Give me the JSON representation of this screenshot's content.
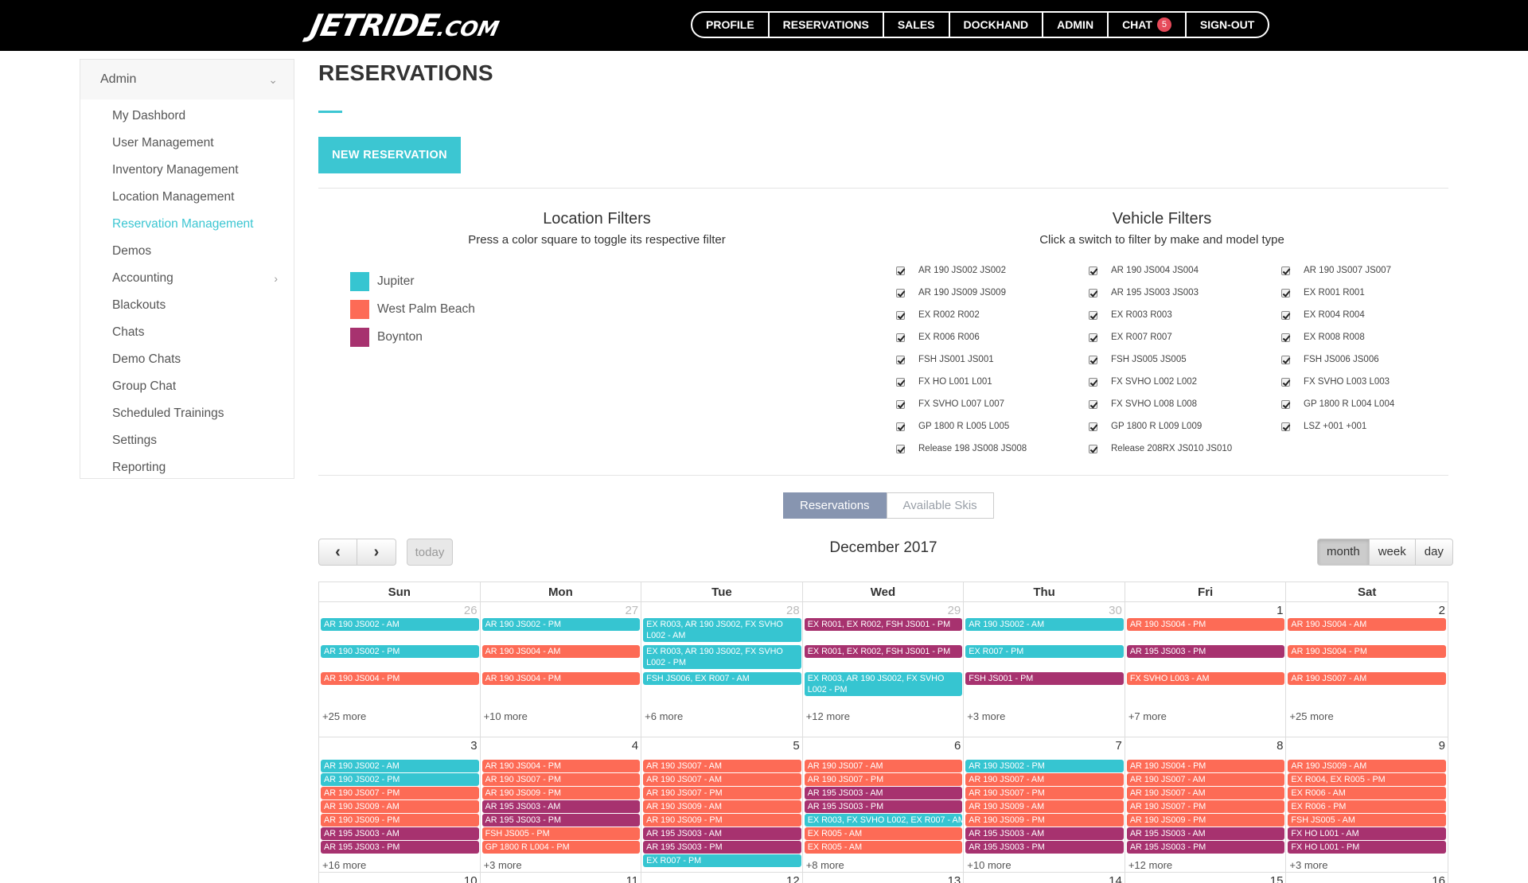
{
  "topnav": {
    "logo_main": "JETRIDE",
    "logo_domain": ".COM",
    "items": [
      "PROFILE",
      "RESERVATIONS",
      "SALES",
      "DOCKHAND",
      "ADMIN",
      "CHAT",
      "SIGN-OUT"
    ],
    "chat_badge": "5"
  },
  "sidebar": {
    "header": "Admin",
    "items": [
      "My Dashbord",
      "User Management",
      "Inventory Management",
      "Location Management",
      "Reservation Management",
      "Demos",
      "Accounting",
      "Blackouts",
      "Chats",
      "Demo Chats",
      "Group Chat",
      "Scheduled Trainings",
      "Settings",
      "Reporting"
    ],
    "active_index": 4
  },
  "page": {
    "title": "RESERVATIONS",
    "new_button": "NEW RESERVATION"
  },
  "location_filters": {
    "title": "Location Filters",
    "subtitle": "Press a color square to toggle its respective filter",
    "locations": [
      {
        "name": "Jupiter",
        "color": "#36c5d1"
      },
      {
        "name": "West Palm Beach",
        "color": "#fd6b56"
      },
      {
        "name": "Boynton",
        "color": "#a7326f"
      }
    ]
  },
  "vehicle_filters": {
    "title": "Vehicle Filters",
    "subtitle": "Click a switch to filter by make and model type",
    "items": [
      "AR 190 JS002 JS002",
      "AR 190 JS004 JS004",
      "AR 190 JS007 JS007",
      "AR 190 JS009 JS009",
      "AR 195 JS003 JS003",
      "EX R001 R001",
      "EX R002 R002",
      "EX R003 R003",
      "EX R004 R004",
      "EX R006 R006",
      "EX R007 R007",
      "EX R008 R008",
      "FSH JS001 JS001",
      "FSH JS005 JS005",
      "FSH JS006 JS006",
      "FX HO L001 L001",
      "FX SVHO L002 L002",
      "FX SVHO L003 L003",
      "FX SVHO L007 L007",
      "FX SVHO L008 L008",
      "GP 1800 R L004 L004",
      "GP 1800 R L005 L005",
      "GP 1800 R L009 L009",
      "LSZ +001 +001",
      "Release 198 JS008 JS008",
      "Release 208RX JS010 JS010"
    ]
  },
  "toggles": {
    "reservations": "Reservations",
    "available": "Available Skis"
  },
  "calendar": {
    "title": "December 2017",
    "prev": "‹",
    "next": "›",
    "today": "today",
    "views": [
      "month",
      "week",
      "day"
    ],
    "day_names": [
      "Sun",
      "Mon",
      "Tue",
      "Wed",
      "Thu",
      "Fri",
      "Sat"
    ],
    "week1_days": [
      "26",
      "27",
      "28",
      "29",
      "30",
      "1",
      "2"
    ],
    "week2_days": [
      "3",
      "4",
      "5",
      "6",
      "7",
      "8",
      "9"
    ],
    "week3_days": [
      "10",
      "11",
      "12",
      "13",
      "14",
      "15",
      "16"
    ],
    "week1_more": [
      "+25 more",
      "+10 more",
      "+6 more",
      "+12 more",
      "+3 more",
      "+7 more",
      "+25 more"
    ],
    "week2_more": [
      "+16 more",
      "+3 more",
      "",
      "+8 more",
      "+10 more",
      "+12 more",
      "+3 more"
    ],
    "week1_events": [
      [
        "AR 190 JS002 - AM",
        "AR 190 JS002 - PM",
        "AR 190 JS004 - PM"
      ],
      [
        "AR 190 JS002 - PM",
        "AR 190 JS004 - AM",
        "AR 190 JS004 - PM"
      ],
      [
        "EX R003, AR 190 JS002, FX SVHO L002 - AM",
        "EX R003, AR 190 JS002, FX SVHO L002 - PM",
        "FSH JS006, EX R007 - AM"
      ],
      [
        "EX R001, EX R002, FSH JS001 - PM",
        "EX R001, EX R002, FSH JS001 - PM",
        "EX R003, AR 190 JS002, FX SVHO L002 - PM"
      ],
      [
        "AR 190 JS002 - AM",
        "EX R007 - PM",
        "FSH JS001 - PM"
      ],
      [
        "AR 190 JS004 - PM",
        "AR 195 JS003 - PM",
        "FX SVHO L003 - AM"
      ],
      [
        "AR 190 JS004 - AM",
        "AR 190 JS004 - PM",
        "AR 190 JS007 - AM"
      ]
    ],
    "week2_events": [
      [
        "AR 190 JS002 - AM",
        "AR 190 JS002 - PM",
        "AR 190 JS007 - PM",
        "AR 190 JS009 - AM",
        "AR 190 JS009 - PM",
        "AR 195 JS003 - AM",
        "AR 195 JS003 - PM"
      ],
      [
        "AR 190 JS004 - PM",
        "AR 190 JS007 - PM",
        "AR 190 JS009 - PM",
        "AR 195 JS003 - AM",
        "AR 195 JS003 - PM",
        "FSH JS005 - PM",
        "GP 1800 R L004 - PM"
      ],
      [
        "AR 190 JS007 - AM",
        "AR 190 JS007 - AM",
        "AR 190 JS007 - PM",
        "AR 190 JS009 - AM",
        "AR 190 JS009 - PM",
        "AR 195 JS003 - AM",
        "AR 195 JS003 - PM",
        "EX R007 - PM"
      ],
      [
        "AR 190 JS007 - AM",
        "AR 190 JS007 - PM",
        "AR 195 JS003 - AM",
        "AR 195 JS003 - PM",
        "EX R003, FX SVHO L002, EX R007 - AM",
        "EX R005 - AM",
        "EX R005 - AM"
      ],
      [
        "AR 190 JS002 - PM",
        "AR 190 JS007 - AM",
        "AR 190 JS007 - PM",
        "AR 190 JS009 - AM",
        "AR 190 JS009 - PM",
        "AR 195 JS003 - AM",
        "AR 195 JS003 - PM"
      ],
      [
        "AR 190 JS004 - PM",
        "AR 190 JS007 - AM",
        "AR 190 JS007 - AM",
        "AR 190 JS007 - PM",
        "AR 190 JS009 - PM",
        "AR 195 JS003 - AM",
        "AR 195 JS003 - PM"
      ],
      [
        "AR 190 JS009 - AM",
        "EX R004, EX R005 - PM",
        "EX R006 - AM",
        "EX R006 - PM",
        "FSH JS005 - AM",
        "FX HO L001 - AM",
        "FX HO L001 - PM"
      ]
    ]
  }
}
